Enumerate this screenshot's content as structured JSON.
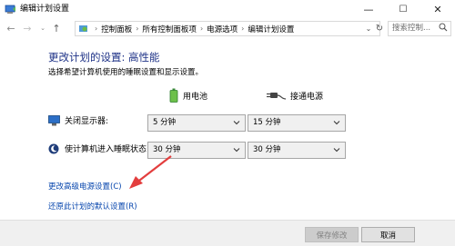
{
  "window": {
    "title": "编辑计划设置",
    "controls": {
      "minimize": "—",
      "maximize": "☐",
      "close": "✕"
    }
  },
  "address": {
    "breadcrumbs": [
      "控制面板",
      "所有控制面板项",
      "电源选项",
      "编辑计划设置"
    ],
    "search_placeholder": "搜索控制..."
  },
  "content": {
    "heading": "更改计划的设置: 高性能",
    "subheading": "选择希望计算机使用的睡眠设置和显示设置。",
    "columns": {
      "battery": "用电池",
      "plugged": "接通电源"
    },
    "rows": [
      {
        "label": "关闭显示器:",
        "battery_value": "5 分钟",
        "plugged_value": "15 分钟"
      },
      {
        "label": "使计算机进入睡眠状态:",
        "battery_value": "30 分钟",
        "plugged_value": "30 分钟"
      }
    ],
    "links": {
      "advanced": "更改高级电源设置(C)",
      "restore": "还原此计划的默认设置(R)"
    }
  },
  "buttons": {
    "save": "保存修改",
    "cancel": "取消"
  },
  "colors": {
    "heading": "#1e3287",
    "link": "#0645ad",
    "arrow": "#e33e3e"
  }
}
